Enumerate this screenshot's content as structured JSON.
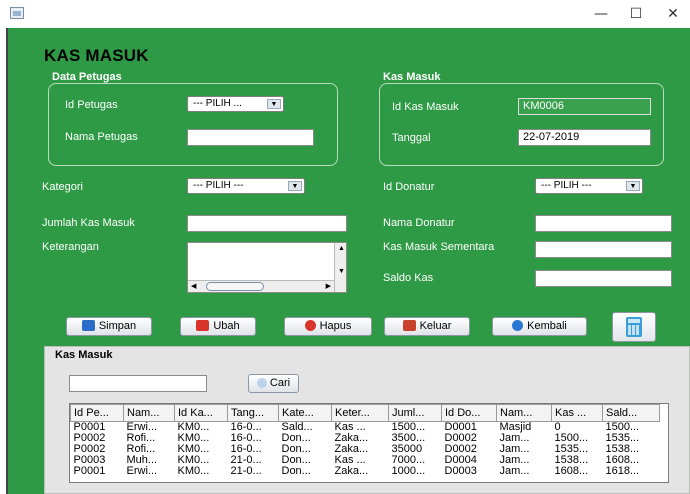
{
  "window": {
    "minimize": "—",
    "maximize": "☐",
    "close": "✕"
  },
  "page_title": "KAS MASUK",
  "data_petugas": {
    "title": "Data Petugas",
    "id_label": "Id Petugas",
    "id_value": "--- PILIH ...",
    "nama_label": "Nama Petugas",
    "nama_value": ""
  },
  "kas_masuk_panel": {
    "title": "Kas Masuk",
    "id_label": "Id Kas Masuk",
    "id_value": "KM0006",
    "tanggal_label": "Tanggal",
    "tanggal_value": "22-07-2019"
  },
  "form": {
    "kategori_label": "Kategori",
    "kategori_value": "--- PILIH ---",
    "id_donatur_label": "Id Donatur",
    "id_donatur_value": "--- PILIH ---",
    "jumlah_label": "Jumlah Kas Masuk",
    "jumlah_value": "",
    "nama_donatur_label": "Nama Donatur",
    "nama_donatur_value": "",
    "keterangan_label": "Keterangan",
    "keterangan_value": "",
    "kas_sementara_label": "Kas Masuk Sementara",
    "kas_sementara_value": "",
    "saldo_label": "Saldo Kas",
    "saldo_value": ""
  },
  "buttons": {
    "simpan": "Simpan",
    "ubah": "Ubah",
    "hapus": "Hapus",
    "keluar": "Keluar",
    "kembali": "Kembali"
  },
  "icons": {
    "app": "java-app-icon",
    "simpan": "save-icon",
    "ubah": "edit-icon",
    "hapus": "delete-icon",
    "keluar": "exit-icon",
    "kembali": "back-arrow-icon",
    "calc": "calculator-icon",
    "cari": "search-icon"
  },
  "search": {
    "section_title": "Kas Masuk",
    "value": "",
    "button": "Cari"
  },
  "table": {
    "columns": [
      "Id Pe...",
      "Nam...",
      "Id Ka...",
      "Tang...",
      "Kate...",
      "Keter...",
      "Juml...",
      "Id Do...",
      "Nam...",
      "Kas ...",
      "Sald..."
    ],
    "rows": [
      [
        "P0001",
        "Erwi...",
        "KM0...",
        "16-0...",
        "Sald...",
        "Kas ...",
        "1500...",
        "D0001",
        "Masjid",
        "0",
        "1500..."
      ],
      [
        "P0002",
        "Rofi...",
        "KM0...",
        "16-0...",
        "Don...",
        "Zaka...",
        "3500...",
        "D0002",
        "Jam...",
        "1500...",
        "1535..."
      ],
      [
        "P0002",
        "Rofi...",
        "KM0...",
        "16-0...",
        "Don...",
        "Zaka...",
        "35000",
        "D0002",
        "Jam...",
        "1535...",
        "1538..."
      ],
      [
        "P0003",
        "Muh...",
        "KM0...",
        "21-0...",
        "Don...",
        "Kas ...",
        "7000...",
        "D0004",
        "Jam...",
        "1538...",
        "1608..."
      ],
      [
        "P0001",
        "Erwi...",
        "KM0...",
        "21-0...",
        "Don...",
        "Zaka...",
        "1000...",
        "D0003",
        "Jam...",
        "1608...",
        "1618..."
      ]
    ]
  },
  "colors": {
    "background": "#2f9a45",
    "lower_panel": "#e4e4e4"
  }
}
